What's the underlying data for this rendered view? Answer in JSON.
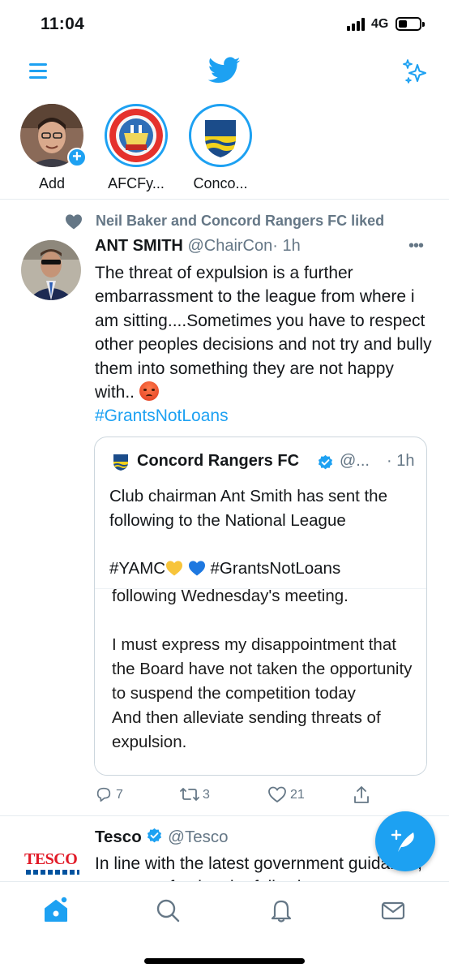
{
  "status_bar": {
    "time": "11:04",
    "network": "4G"
  },
  "fleets": [
    {
      "label": "Add"
    },
    {
      "label": "AFCFy..."
    },
    {
      "label": "Conco..."
    }
  ],
  "tweet1": {
    "social_context": "Neil Baker and Concord Rangers FC liked",
    "name": "ANT SMITH",
    "handle": "@ChairCon",
    "time": "· 1h",
    "text": "The threat of expulsion is a further embarrassment to the league from where i am sitting....Sometimes you have to respect other peoples decisions and not try and bully them into something they are not happy with..",
    "hashtag": "#GrantsNotLoans",
    "quote": {
      "name": "Concord Rangers FC",
      "handle": "@...",
      "time": "· 1h",
      "text_line1": "Club chairman Ant Smith has sent the following to the National League",
      "tag1": "#YAMC",
      "tag2": "#GrantsNotLoans",
      "image_text": "following Wednesday's meeting.\n\nI must express my disappointment that the Board have not taken the opportunity to suspend the competition today\nAnd then alleviate sending threats of expulsion."
    },
    "actions": {
      "replies": "7",
      "retweets": "3",
      "likes": "21"
    }
  },
  "tweet2": {
    "name": "Tesco",
    "handle": "@Tesco",
    "avatar_text": "TESCO",
    "text": "In line with the latest government guidance, we are enforcing the following"
  },
  "colors": {
    "accent": "#1da1f2",
    "secondary_text": "#657786",
    "tesco_red": "#e11a27",
    "tesco_blue": "#00539f"
  }
}
